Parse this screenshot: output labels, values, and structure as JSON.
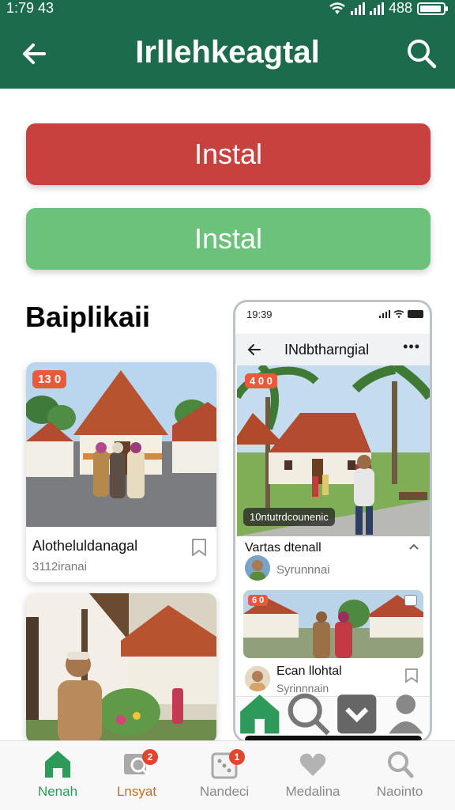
{
  "status": {
    "time": "1:79 43",
    "battery": "488"
  },
  "appbar": {
    "title": "Irllehkeagtal"
  },
  "buttons": {
    "install_red": "Instal",
    "install_green": "Instal"
  },
  "section": {
    "title": "Baiplikaii"
  },
  "cards": [
    {
      "badge": "13 0",
      "title": "Alotheluldanagal",
      "subtitle": "3112iranai"
    },
    {
      "badge": ""
    }
  ],
  "phone": {
    "time": "19:39",
    "title": "INdbtharngial",
    "more": "•••",
    "image_badge": "4 0 0",
    "image_overlay": "10ntutrdcounenic",
    "section_title": "Vartas dtenall",
    "author1": "Syrunnnai",
    "card_badge": "6 0",
    "item_title": "Ecan llohtal",
    "author2": "Syrinnnain"
  },
  "bottom_nav": [
    {
      "label": "Nenah",
      "icon": "home-icon",
      "active": true
    },
    {
      "label": "Lnsyat",
      "icon": "search-list-icon",
      "badge": "2"
    },
    {
      "label": "Nandeci",
      "icon": "dice-icon",
      "badge": "1"
    },
    {
      "label": "Medalina",
      "icon": "heart-icon"
    },
    {
      "label": "Naointo",
      "icon": "search-icon"
    }
  ],
  "colors": {
    "appbar": "#1d6b4d",
    "install_red": "#c9413e",
    "install_green": "#6cc27a",
    "active_nav": "#2e9a5a",
    "badge": "#e2452d"
  }
}
